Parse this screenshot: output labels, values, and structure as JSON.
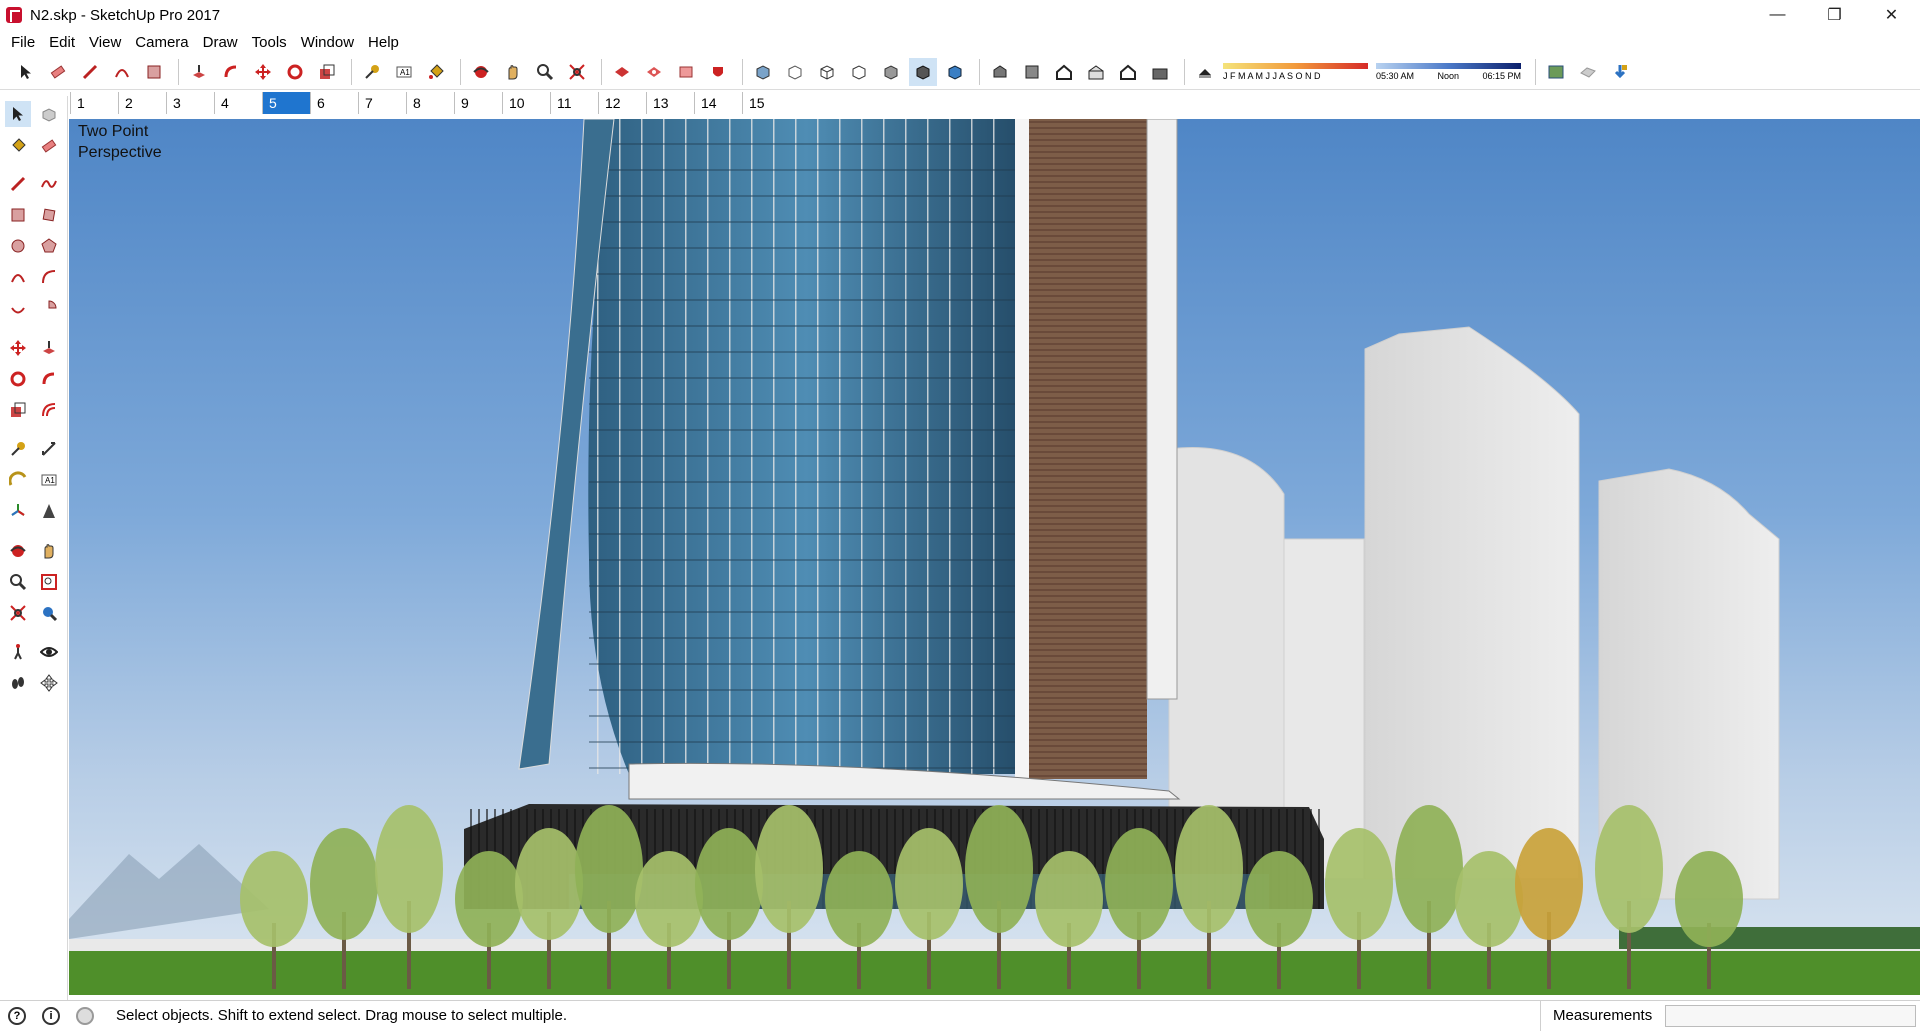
{
  "window": {
    "title": "N2.skp - SketchUp Pro 2017",
    "minimize": "—",
    "maximize": "❐",
    "close": "✕"
  },
  "menu": [
    "File",
    "Edit",
    "View",
    "Camera",
    "Draw",
    "Tools",
    "Window",
    "Help"
  ],
  "scenes": {
    "tabs": [
      "1",
      "2",
      "3",
      "4",
      "5",
      "6",
      "7",
      "8",
      "9",
      "10",
      "11",
      "12",
      "13",
      "14",
      "15"
    ],
    "active_index": 4
  },
  "shadows": {
    "months": "J F M A M J J A S O N D",
    "sunrise": "05:30 AM",
    "noon": "Noon",
    "sunset": "06:15 PM"
  },
  "viewport": {
    "camera_label_line1": "Two Point",
    "camera_label_line2": "Perspective"
  },
  "status": {
    "hint": "Select objects. Shift to extend select. Drag mouse to select multiple.",
    "measurements_label": "Measurements",
    "measurements_value": ""
  },
  "colors": {
    "accent": "#1f75cf",
    "sky_top": "#4f86c6",
    "ground": "#4f8f2a",
    "glass": "#3f7aa0"
  }
}
